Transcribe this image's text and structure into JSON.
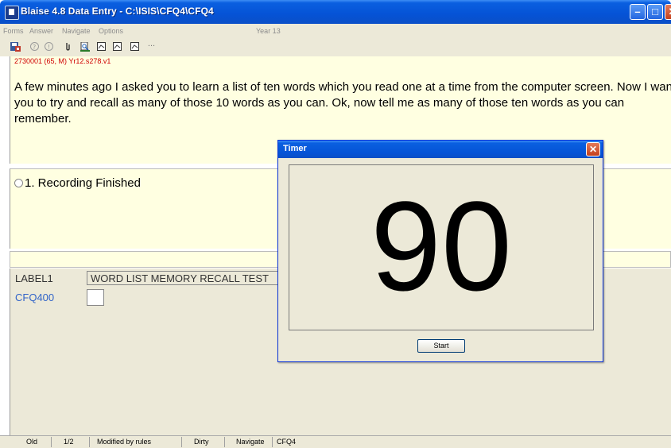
{
  "window": {
    "title": "Blaise 4.8 Data Entry - C:\\ISIS\\CFQ4\\CFQ4",
    "min_glyph": "–",
    "max_glyph": "□",
    "close_glyph": "✕"
  },
  "menu": {
    "items": [
      "Forms",
      "Answer",
      "Navigate",
      "Options"
    ],
    "year_label": "Year 13"
  },
  "toolbar": {
    "icons": [
      "save-icon",
      "help-icon",
      "info-icon",
      "attach-icon",
      "search-doc-icon",
      "page-1-icon",
      "page-2-icon",
      "page-3-icon",
      "more-icon"
    ],
    "more_label": "..."
  },
  "question": {
    "record_id": "2730001 (65, M) Yr12.s278.v1",
    "text": "A few minutes ago I asked you to learn a list of ten words which you read one at a time from the computer screen.  Now I want you to try and recall as many of those 10 words as you can.  Ok, now tell me as many of those ten words as you can remember."
  },
  "answers": {
    "options": [
      "1. Recording Finished"
    ]
  },
  "fields": {
    "label1_name": "LABEL1",
    "label1_value": "WORD LIST MEMORY RECALL TEST",
    "cfq400_name": "CFQ400",
    "cfq400_value": ""
  },
  "status": {
    "mode": "Old",
    "page": "1/2",
    "modified": "Modified by rules",
    "dirty": "Dirty",
    "navigate": "Navigate",
    "field": "CFQ4"
  },
  "timer": {
    "title": "Timer",
    "close_glyph": "✕",
    "count": "90",
    "start_label": "Start"
  },
  "colors": {
    "titlebar": "#0553d6",
    "question_bg": "#ffffe1",
    "record_id": "#d00000",
    "field_name_blue": "#3264c8",
    "panel_bg": "#ece9d8"
  }
}
